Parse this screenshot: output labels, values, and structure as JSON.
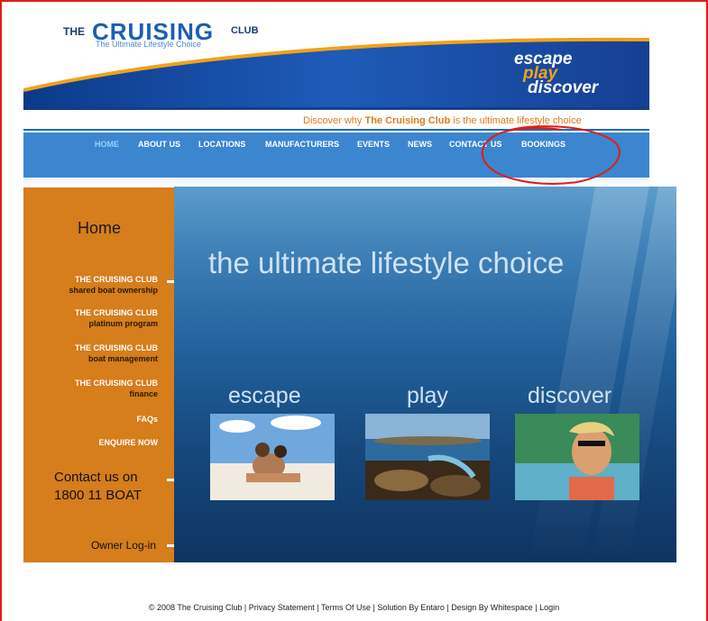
{
  "header": {
    "logo_the": "THE",
    "logo_main": "CRUISING",
    "logo_club": "CLUB",
    "logo_tagline": "The Ultimate Lifestyle Choice",
    "slogan": [
      "escape",
      "play",
      "discover"
    ],
    "discover_prefix": "Discover why ",
    "discover_brand": "The Cruising Club",
    "discover_suffix": " is the ultimate lifestyle choice"
  },
  "nav": {
    "items": [
      "HOME",
      "ABOUT US",
      "LOCATIONS",
      "MANUFACTURERS",
      "EVENTS",
      "NEWS",
      "CONTACT US",
      "BOOKINGS"
    ],
    "active": "HOME"
  },
  "sidebar": {
    "title": "Home",
    "links": [
      {
        "main": "THE CRUISING CLUB",
        "sub": "shared boat ownership"
      },
      {
        "main": "THE CRUISING CLUB",
        "sub": "platinum program"
      },
      {
        "main": "THE CRUISING CLUB",
        "sub": "boat management"
      },
      {
        "main": "THE CRUISING CLUB",
        "sub": "finance"
      },
      {
        "main": "FAQs",
        "sub": ""
      },
      {
        "main": "ENQUIRE NOW",
        "sub": ""
      }
    ],
    "contact_line1": "Contact us on",
    "contact_line2": "1800 11 BOAT",
    "owner_login": "Owner Log-in"
  },
  "hero": {
    "title": "the ultimate lifestyle choice",
    "words": [
      "escape",
      "play",
      "discover"
    ]
  },
  "footer": {
    "items": [
      "© 2008 The Cruising Club",
      "Privacy Statement",
      "Terms Of Use",
      "Solution By Entaro",
      "Design By Whitespace",
      "Login"
    ],
    "separator": " | "
  },
  "colors": {
    "accent_orange": "#d67d1c",
    "nav_blue": "#3b86cf",
    "annotation_red": "#e41b17"
  }
}
